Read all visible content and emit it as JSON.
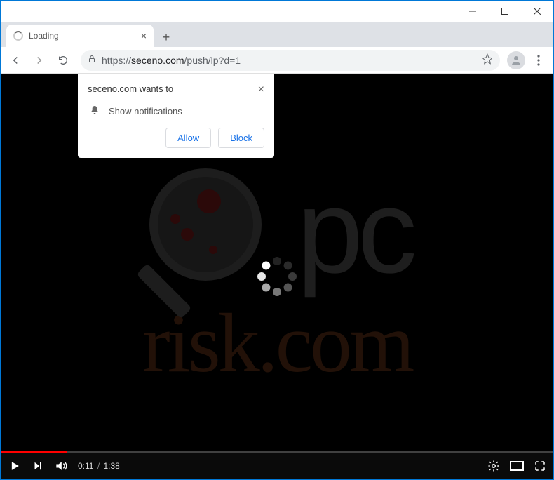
{
  "tab": {
    "title": "Loading"
  },
  "address": {
    "protocol": "https://",
    "host": "seceno.com",
    "path": "/push/lp?d=1"
  },
  "permission_popup": {
    "origin_wants_to": "seceno.com wants to",
    "permission_label": "Show notifications",
    "allow_label": "Allow",
    "block_label": "Block"
  },
  "watermark": {
    "pc_text": "pc",
    "risk_text": "risk.com"
  },
  "video": {
    "current_time": "0:11",
    "duration": "1:38",
    "progress_percent": 12
  }
}
